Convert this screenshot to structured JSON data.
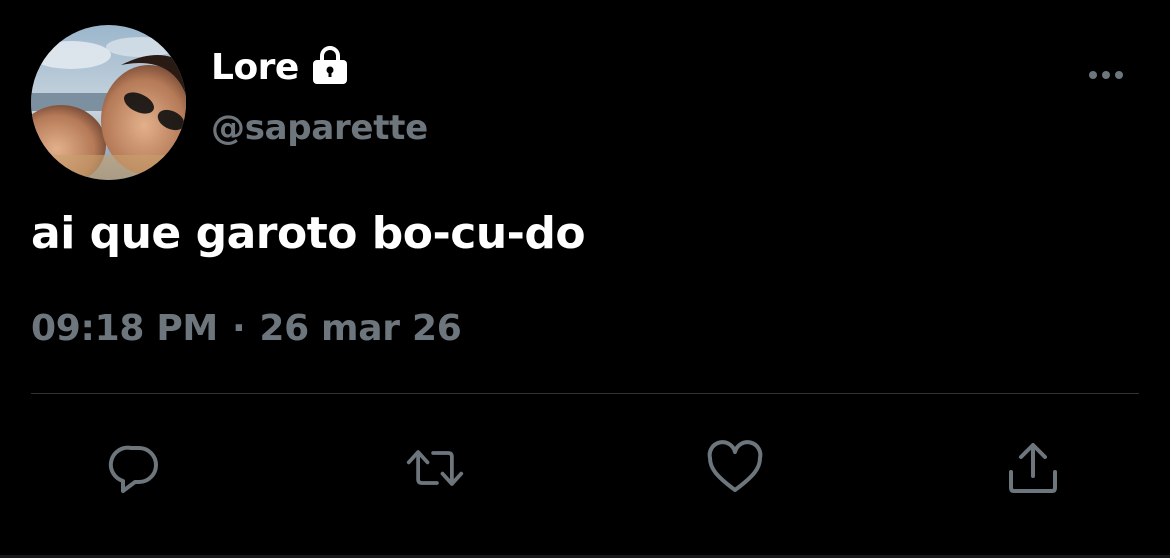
{
  "tweet": {
    "display_name": "Lore",
    "handle": "@saparette",
    "text": "ai que garoto bo-cu-do",
    "time": "09:18 PM",
    "separator": "·",
    "date": "26 mar 26",
    "protected_icon": "lock-icon",
    "avatar_icon": "avatar"
  },
  "actions": [
    {
      "name": "reply",
      "icon": "reply-icon"
    },
    {
      "name": "retweet",
      "icon": "retweet-icon"
    },
    {
      "name": "like",
      "icon": "heart-icon"
    },
    {
      "name": "share",
      "icon": "share-icon"
    }
  ],
  "colors": {
    "background": "#000000",
    "primary_text": "#ffffff",
    "secondary_text": "#6e767d",
    "divider": "#2f3336"
  }
}
